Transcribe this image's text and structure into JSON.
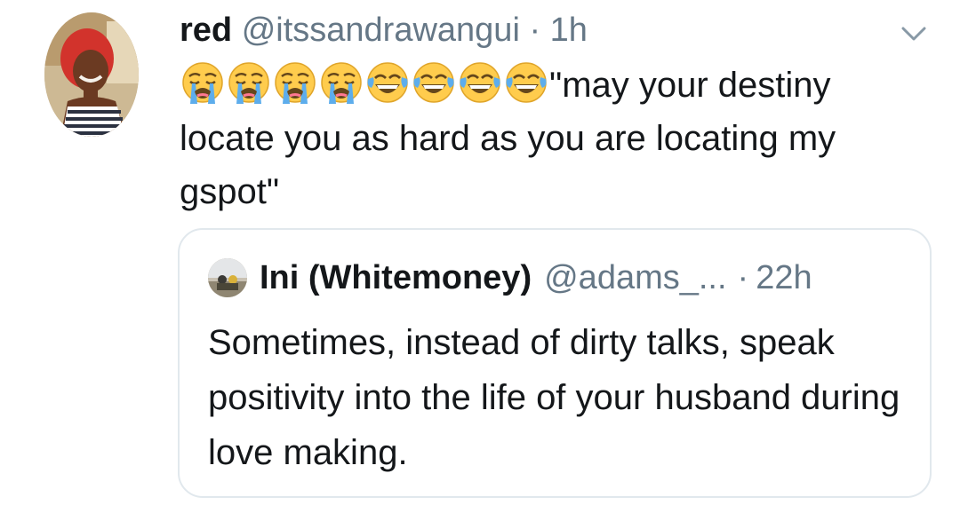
{
  "tweet": {
    "display_name": "red",
    "handle": "@itssandrawangui",
    "separator": "·",
    "time": "1h",
    "emojis": [
      "loudly-crying-face",
      "loudly-crying-face",
      "loudly-crying-face",
      "loudly-crying-face",
      "face-with-tears-of-joy",
      "face-with-tears-of-joy",
      "face-with-tears-of-joy",
      "face-with-tears-of-joy"
    ],
    "text": "\"may your destiny locate you as hard as you are locating my gspot\""
  },
  "quoted_tweet": {
    "display_name": "Ini (Whitemoney)",
    "handle": "@adams_...",
    "separator": "·",
    "time": "22h",
    "text": "Sometimes, instead of dirty talks, speak positivity into the life of your husband during love making."
  },
  "colors": {
    "text_primary": "#14171a",
    "text_secondary": "#657786",
    "border": "#e1e8ed",
    "emoji_yellow": "#ffcc4d",
    "emoji_tear": "#5dadec"
  },
  "icons": {
    "menu": "chevron-down-icon"
  }
}
